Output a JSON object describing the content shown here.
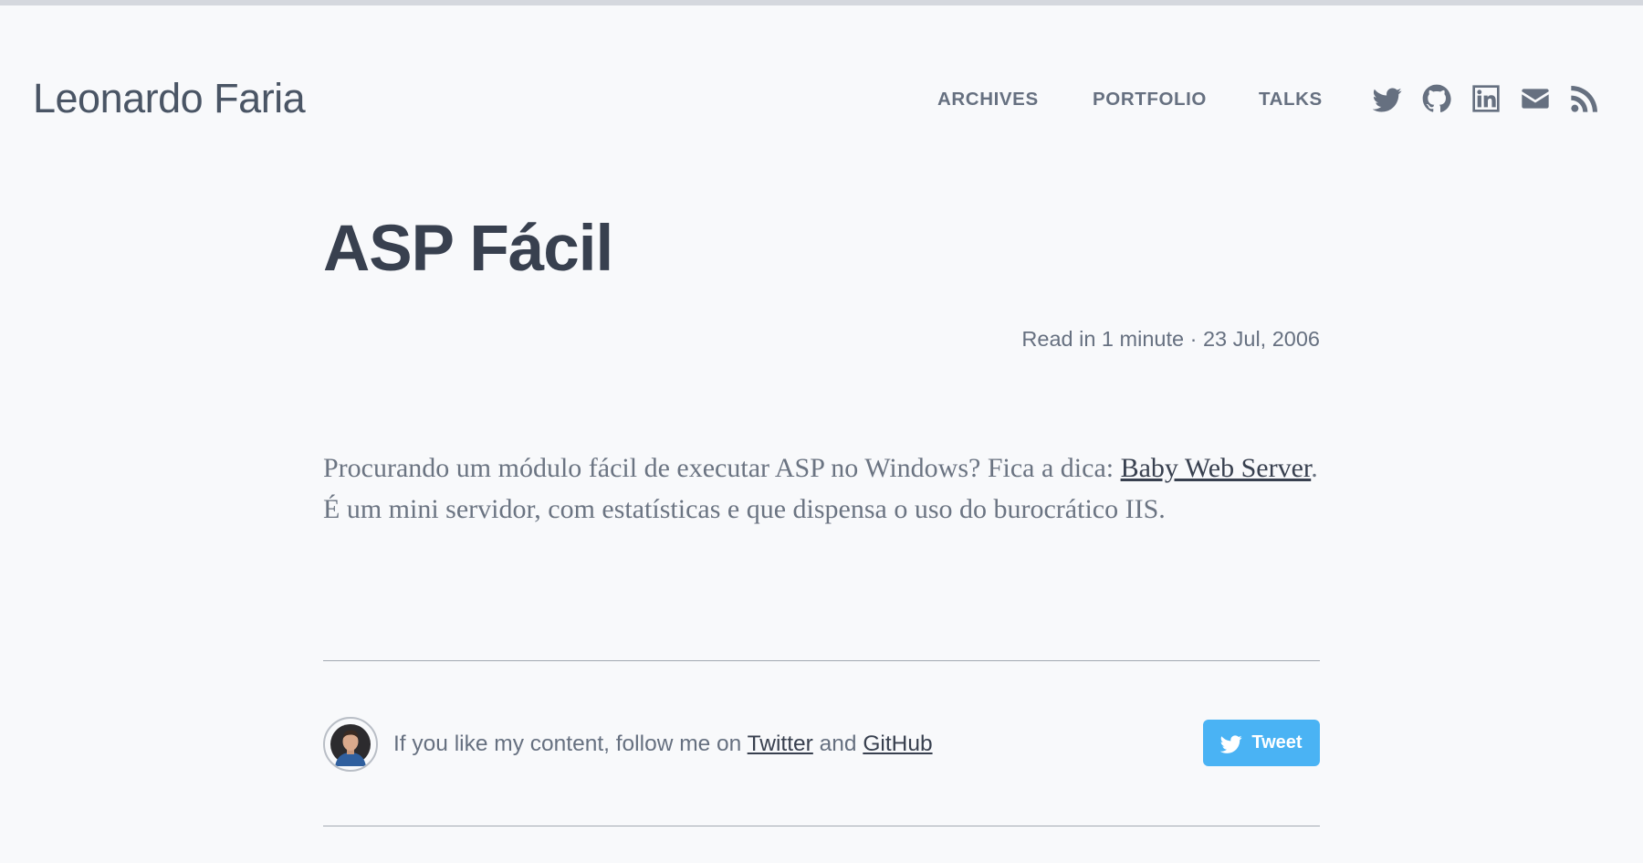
{
  "header": {
    "site_title": "Leonardo Faria",
    "nav": {
      "archives": "ARCHIVES",
      "portfolio": "PORTFOLIO",
      "talks": "TALKS"
    },
    "social_icons": [
      "twitter-icon",
      "github-icon",
      "linkedin-icon",
      "email-icon",
      "rss-icon"
    ]
  },
  "post": {
    "title": "ASP Fácil",
    "meta": "Read in 1 minute · 23 Jul, 2006",
    "content": {
      "text_before_link": "Procurando um módulo fácil de executar ASP no Windows? Fica a dica: ",
      "link_text": "Baby Web Server",
      "text_after_link": ". É um mini servidor, com estatísticas e que dispensa o uso do burocrático IIS."
    }
  },
  "follow": {
    "text_before": "If you like my content, follow me on ",
    "twitter_link": "Twitter",
    "conjunction": " and ",
    "github_link": "GitHub",
    "tweet_button_label": "Tweet"
  },
  "colors": {
    "background": "#f8f9fb",
    "title_text": "#38404f",
    "muted_text": "#667080",
    "tweet_button": "#4ab3f4"
  }
}
